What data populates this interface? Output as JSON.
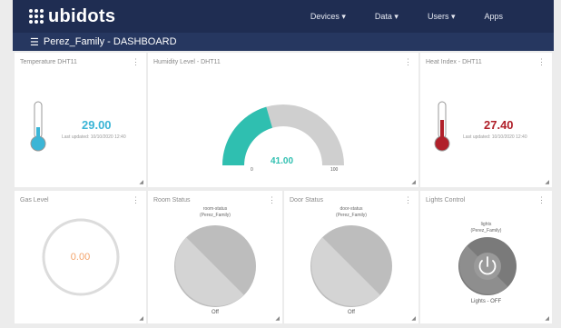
{
  "header": {
    "logo_text": "ubidots",
    "nav": [
      "Devices ▾",
      "Data ▾",
      "Users ▾",
      "Apps"
    ]
  },
  "subheader": {
    "menu_icon": "☰",
    "title": "Perez_Family - DASHBOARD"
  },
  "widgets": {
    "temperature": {
      "title": "Temperature DHT11",
      "value": "29.00",
      "updated": "Last updated: 10/10/2020 12:40",
      "color": "#3bb5d6"
    },
    "humidity": {
      "title": "Humidity Level - DHT11",
      "value": "41.00",
      "min": "0",
      "max": "100",
      "color": "#2fbfb0"
    },
    "heat_index": {
      "title": "Heat Index - DHT11",
      "value": "27.40",
      "updated": "Last updated: 10/10/2020 12:40",
      "color": "#b0202a"
    },
    "gas": {
      "title": "Gas Level",
      "value": "0.00",
      "color": "#f3a36a"
    },
    "room": {
      "title": "Room Status",
      "inner_title": "room-status",
      "inner_sub": "(Perez_Family)",
      "state": "Off"
    },
    "door": {
      "title": "Door Status",
      "inner_title": "door-status",
      "inner_sub": "(Perez_Family)",
      "state": "Off"
    },
    "lights": {
      "title": "Lights Control",
      "inner_title": "lights",
      "inner_sub": "(Perez_Family)",
      "state": "Lights - OFF"
    }
  }
}
